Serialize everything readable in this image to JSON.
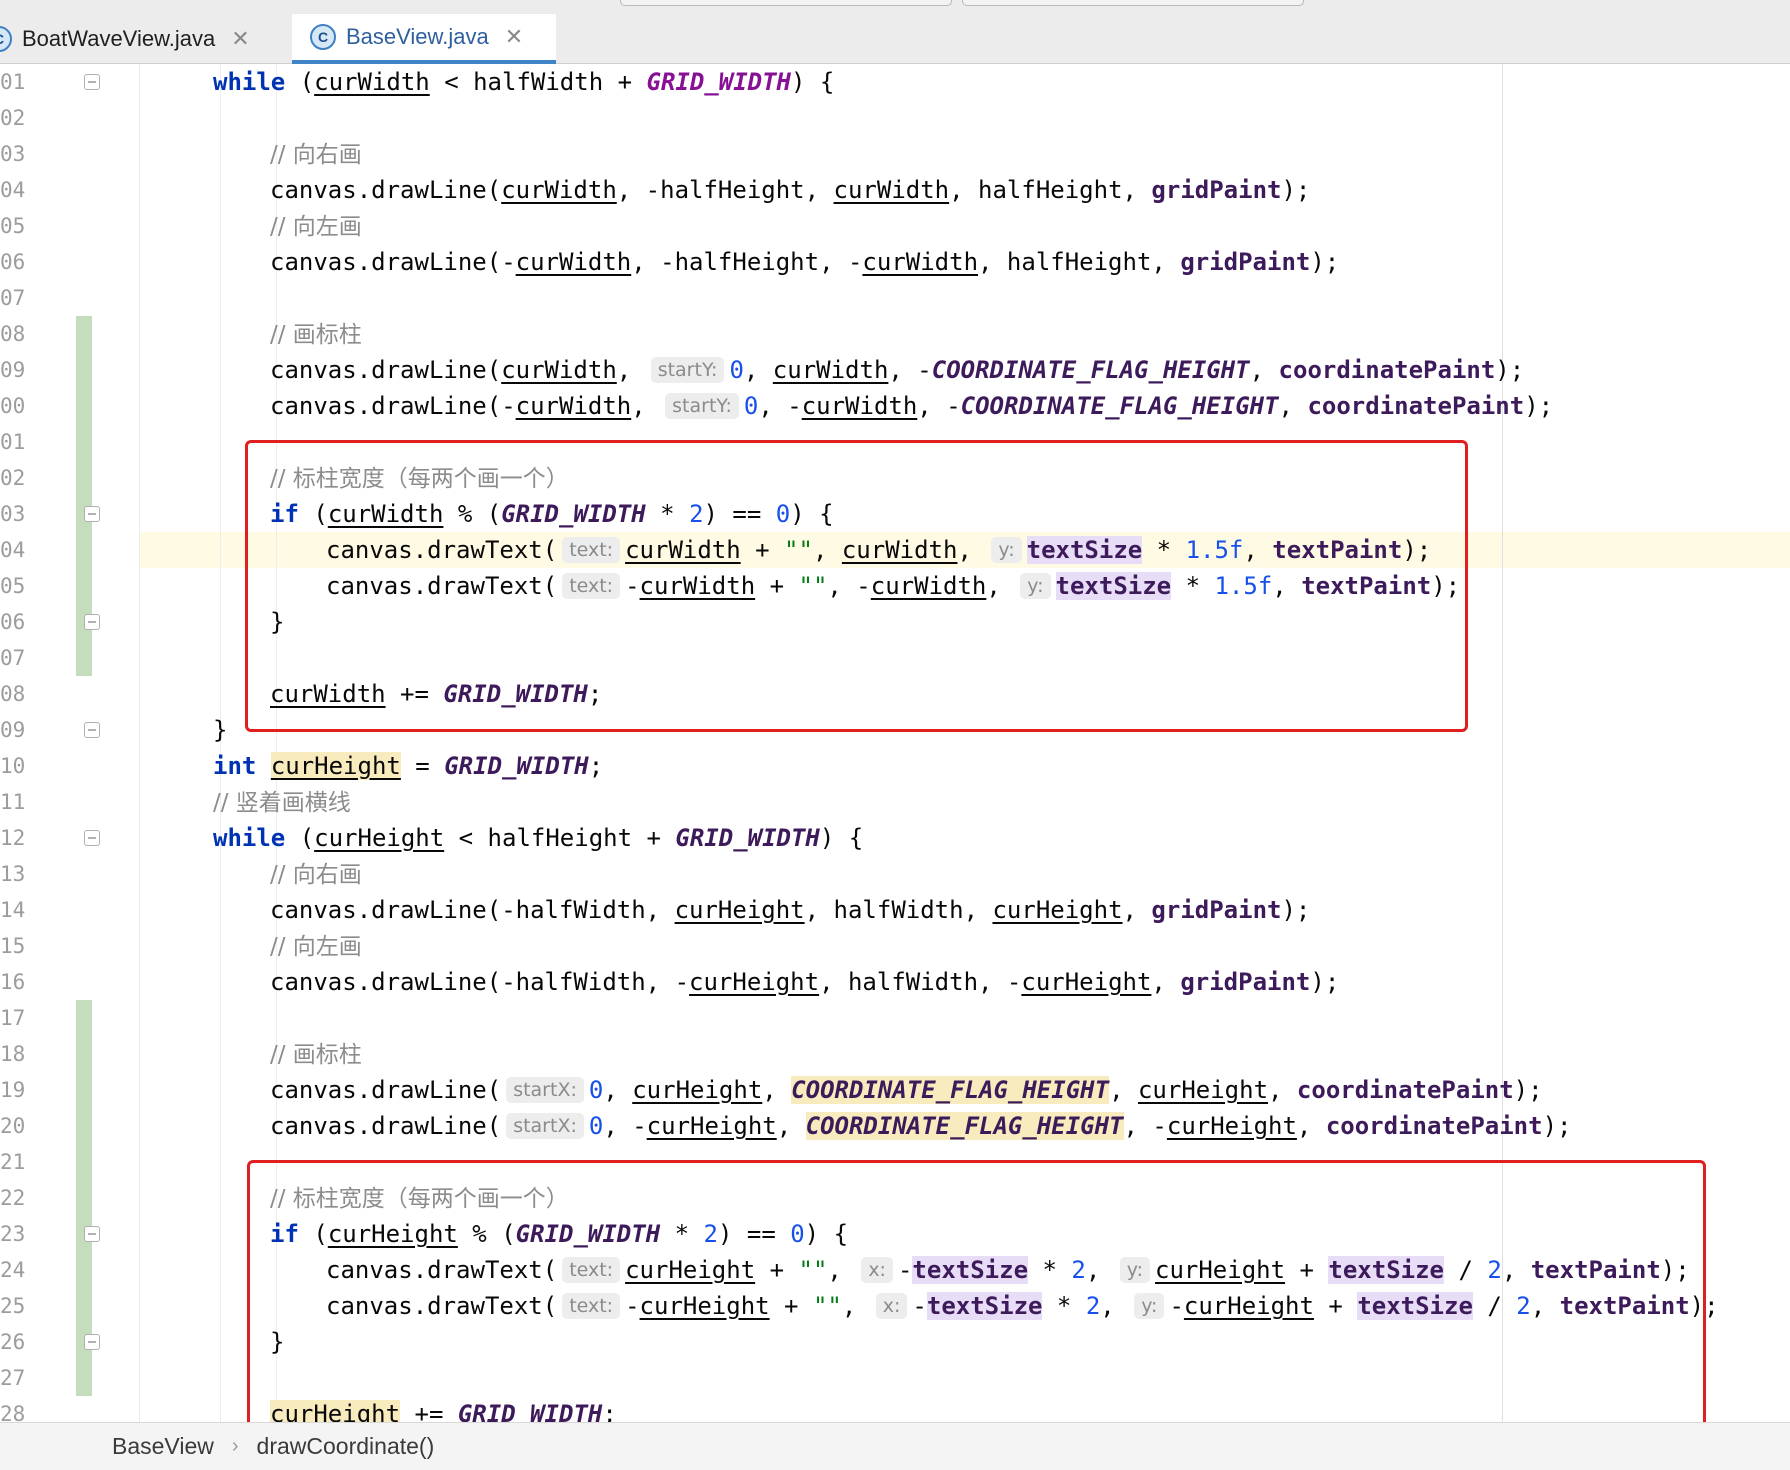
{
  "tabs": [
    {
      "label": "BoatWaveView.java",
      "icon": "java-class-icon",
      "active": false
    },
    {
      "label": "BaseView.java",
      "icon": "java-class-icon",
      "active": true
    }
  ],
  "gutter": {
    "line_numbers": [
      "01",
      "02",
      "03",
      "04",
      "05",
      "06",
      "07",
      "08",
      "09",
      "00",
      "01",
      "02",
      "03",
      "04",
      "05",
      "06",
      "07",
      "08",
      "09",
      "10",
      "11",
      "12",
      "13",
      "14",
      "15",
      "16",
      "17",
      "18",
      "19",
      "20",
      "21",
      "22",
      "23",
      "24",
      "25",
      "26",
      "27",
      "28"
    ]
  },
  "code": {
    "l0": {
      "kw": "while",
      "a": " (",
      "v1": "curWidth",
      "b": " < halfWidth + ",
      "c1": "GRID_WIDTH",
      "d": ") {"
    },
    "l2": {
      "cm": "// 向右画"
    },
    "l3": {
      "a": "canvas.drawLine(",
      "v1": "curWidth",
      "b": ", -halfHeight, ",
      "v2": "curWidth",
      "c": ", halfHeight, ",
      "f1": "gridPaint",
      "d": ");"
    },
    "l4": {
      "cm": "// 向左画"
    },
    "l5": {
      "a": "canvas.drawLine(-",
      "v1": "curWidth",
      "b": ", -halfHeight, -",
      "v2": "curWidth",
      "c": ", halfHeight, ",
      "f1": "gridPaint",
      "d": ");"
    },
    "l7": {
      "cm": "// 画标柱"
    },
    "l8": {
      "a": "canvas.drawLine(",
      "v1": "curWidth",
      "b": ", ",
      "h1": "startY:",
      "n1": "0",
      "c": ", ",
      "v2": "curWidth",
      "d": ", -",
      "c1": "COORDINATE_FLAG_HEIGHT",
      "e": ", ",
      "f1": "coordinatePaint",
      "g": ");"
    },
    "l9": {
      "a": "canvas.drawLine(-",
      "v1": "curWidth",
      "b": ", ",
      "h1": "startY:",
      "n1": "0",
      "c": ", -",
      "v2": "curWidth",
      "d": ", -",
      "c1": "COORDINATE_FLAG_HEIGHT",
      "e": ", ",
      "f1": "coordinatePaint",
      "g": ");"
    },
    "l11": {
      "cm": "// 标柱宽度（每两个画一个）"
    },
    "l12": {
      "kw": "if",
      "a": " (",
      "v1": "curWidth",
      "b": " % (",
      "c1": "GRID_WIDTH",
      "c": " * ",
      "n1": "2",
      "d": ") == ",
      "n2": "0",
      "e": ") {"
    },
    "l13": {
      "a": "canvas.drawText(",
      "h1": "text:",
      "v1": "curWidth",
      "b": " + ",
      "s1": "\"\"",
      "c": ", ",
      "v2": "curWidth",
      "d": ", ",
      "h2": "y:",
      "f1": "textSize",
      "e": " * ",
      "n1": "1.5f",
      "f": ", ",
      "f2": "textPaint",
      "g": ");"
    },
    "l14": {
      "a": "canvas.drawText(",
      "h1": "text:",
      "b0": "-",
      "v1": "curWidth",
      "b": " + ",
      "s1": "\"\"",
      "c": ", -",
      "v2": "curWidth",
      "d": ", ",
      "h2": "y:",
      "f1": "textSize",
      "e": " * ",
      "n1": "1.5f",
      "f": ", ",
      "f2": "textPaint",
      "g": ");"
    },
    "l15": {
      "a": "}"
    },
    "l17": {
      "v1": "curWidth",
      "a": " += ",
      "c1": "GRID_WIDTH",
      "b": ";"
    },
    "l18": {
      "a": "}"
    },
    "l19": {
      "kw": "int",
      "a": " ",
      "v1": "curHeight",
      "b": " = ",
      "c1": "GRID_WIDTH",
      "c": ";"
    },
    "l20": {
      "cm": "// 竖着画横线"
    },
    "l21": {
      "kw": "while",
      "a": " (",
      "v1": "curHeight",
      "b": " < halfHeight + ",
      "c1": "GRID_WIDTH",
      "d": ") {"
    },
    "l22": {
      "cm": "// 向右画"
    },
    "l23": {
      "a": "canvas.drawLine(-halfWidth, ",
      "v1": "curHeight",
      "b": ", halfWidth, ",
      "v2": "curHeight",
      "c": ", ",
      "f1": "gridPaint",
      "d": ");"
    },
    "l24": {
      "cm": "// 向左画"
    },
    "l25": {
      "a": "canvas.drawLine(-halfWidth, -",
      "v1": "curHeight",
      "b": ", halfWidth, -",
      "v2": "curHeight",
      "c": ", ",
      "f1": "gridPaint",
      "d": ");"
    },
    "l27": {
      "cm": "// 画标柱"
    },
    "l28": {
      "a": "canvas.drawLine(",
      "h1": "startX:",
      "n1": "0",
      "b": ", ",
      "v1": "curHeight",
      "c": ", ",
      "c1": "COORDINATE_FLAG_HEIGHT",
      "d": ", ",
      "v2": "curHeight",
      "e": ", ",
      "f1": "coordinatePaint",
      "g": ");"
    },
    "l29": {
      "a": "canvas.drawLine(",
      "h1": "startX:",
      "n1": "0",
      "b": ", -",
      "v1": "curHeight",
      "c": ", ",
      "c1": "COORDINATE_FLAG_HEIGHT",
      "d": ", -",
      "v2": "curHeight",
      "e": ", ",
      "f1": "coordinatePaint",
      "g": ");"
    },
    "l31": {
      "cm": "// 标柱宽度（每两个画一个）"
    },
    "l32": {
      "kw": "if",
      "a": " (",
      "v1": "curHeight",
      "b": " % (",
      "c1": "GRID_WIDTH",
      "c": " * ",
      "n1": "2",
      "d": ") == ",
      "n2": "0",
      "e": ") {"
    },
    "l33": {
      "a": "canvas.drawText(",
      "h1": "text:",
      "v1": "curHeight",
      "b": " + ",
      "s1": "\"\"",
      "c": ", ",
      "h2": "x:",
      "d": "-",
      "f1": "textSize",
      "e": " * ",
      "n1": "2",
      "f": ", ",
      "h3": "y:",
      "v2": "curHeight",
      "g": " + ",
      "f2": "textSize",
      "i": " / ",
      "n2": "2",
      "j": ", ",
      "f3": "textPaint",
      "k": ");"
    },
    "l34": {
      "a": "canvas.drawText(",
      "h1": "text:",
      "b0": "-",
      "v1": "curHeight",
      "b": " + ",
      "s1": "\"\"",
      "c": ", ",
      "h2": "x:",
      "d": "-",
      "f1": "textSize",
      "e": " * ",
      "n1": "2",
      "f": ", ",
      "h3": "y:",
      "d2": "-",
      "v2": "curHeight",
      "g": " + ",
      "f2": "textSize",
      "i": " / ",
      "n2": "2",
      "j": ", ",
      "f3": "textPaint",
      "k": ");"
    },
    "l35": {
      "a": "}"
    },
    "l37": {
      "v1": "curHeight",
      "a": " += ",
      "c1": "GRID_WIDTH",
      "b": ";"
    }
  },
  "breadcrumb": {
    "items": [
      "BaseView",
      "drawCoordinate()"
    ],
    "separator": "›"
  },
  "colors": {
    "keyword": "#0033b3",
    "constant": "#871094",
    "field": "#3d1a5a",
    "number": "#1750eb",
    "string": "#067d17",
    "comment": "#8c8c8c",
    "annotation_box": "#e02020"
  }
}
